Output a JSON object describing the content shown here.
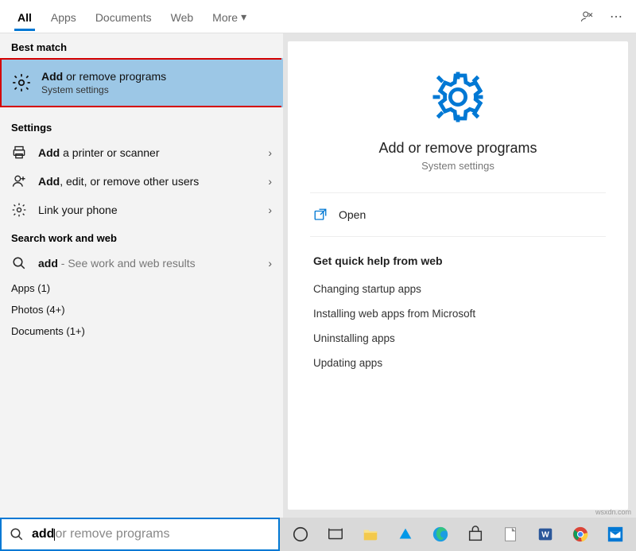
{
  "tabs": {
    "all": "All",
    "apps": "Apps",
    "documents": "Documents",
    "web": "Web",
    "more": "More"
  },
  "sections": {
    "best": "Best match",
    "settings": "Settings",
    "searchweb": "Search work and web"
  },
  "bestmatch": {
    "title_bold": "Add",
    "title_rest": " or remove programs",
    "sub": "System settings"
  },
  "settings": [
    {
      "icon": "printer",
      "bold": "Add",
      "rest": " a printer or scanner"
    },
    {
      "icon": "person",
      "bold": "Add",
      "rest": ", edit, or remove other users"
    },
    {
      "icon": "gear",
      "bold": "",
      "rest": "Link your phone"
    }
  ],
  "websearch": {
    "bold": "add",
    "rest": " - See work and web results"
  },
  "categories": {
    "apps": "Apps (1)",
    "photos": "Photos (4+)",
    "documents": "Documents (1+)"
  },
  "detail": {
    "title": "Add or remove programs",
    "sub": "System settings",
    "open": "Open",
    "helphdr": "Get quick help from web",
    "links": [
      "Changing startup apps",
      "Installing web apps from Microsoft",
      "Uninstalling apps",
      "Updating apps"
    ]
  },
  "search": {
    "typed": "add",
    "placeholder": " or remove programs"
  },
  "watermark": "wsxdn.com"
}
